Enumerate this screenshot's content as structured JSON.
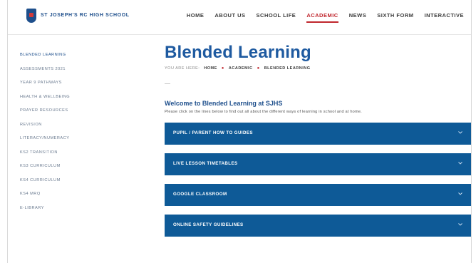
{
  "header": {
    "logo_text": "ST JOSEPH'S RC HIGH SCHOOL",
    "logo_sub": "",
    "nav": [
      {
        "label": "HOME",
        "active": false
      },
      {
        "label": "ABOUT US",
        "active": false
      },
      {
        "label": "SCHOOL LIFE",
        "active": false
      },
      {
        "label": "ACADEMIC",
        "active": true
      },
      {
        "label": "NEWS",
        "active": false
      },
      {
        "label": "SIXTH FORM",
        "active": false
      },
      {
        "label": "INTERACTIVE",
        "active": false
      }
    ]
  },
  "sidebar": {
    "items": [
      {
        "label": "BLENDED LEARNING",
        "active": true
      },
      {
        "label": "ASSESSMENTS 2021",
        "active": false
      },
      {
        "label": "YEAR 9 PATHWAYS",
        "active": false
      },
      {
        "label": "HEALTH & WELLBEING",
        "active": false
      },
      {
        "label": "PRAYER RESOURCES",
        "active": false
      },
      {
        "label": "REVISION",
        "active": false
      },
      {
        "label": "LITERACY/NUMERACY",
        "active": false
      },
      {
        "label": "KS2 TRANSITION",
        "active": false
      },
      {
        "label": "KS3 CURRICULUM",
        "active": false
      },
      {
        "label": "KS4 CURRICULUM",
        "active": false
      },
      {
        "label": "KS4 MRQ",
        "active": false
      },
      {
        "label": "E-LIBRARY",
        "active": false
      }
    ]
  },
  "main": {
    "title": "Blended Learning",
    "breadcrumb": {
      "prefix": "YOU ARE HERE:",
      "items": [
        "HOME",
        "ACADEMIC",
        "BLENDED LEARNING"
      ]
    },
    "welcome_heading": "Welcome to Blended Learning at SJHS",
    "intro": "Please click on the lines below to find out all about the different ways of learning in school and at home.",
    "accordion": [
      {
        "label": "PUPIL / PARENT HOW TO GUIDES"
      },
      {
        "label": "LIVE LESSON TIMETABLES"
      },
      {
        "label": "GOOGLE CLASSROOM"
      },
      {
        "label": "ONLINE SAFETY GUIDELINES"
      }
    ]
  },
  "colors": {
    "brand_blue": "#1e4f8c",
    "accordion_blue": "#0e5a97",
    "accent_red": "#c0262d"
  },
  "icons": {
    "accordion": "chevron-down-icon",
    "logo": "school-crest-icon"
  }
}
